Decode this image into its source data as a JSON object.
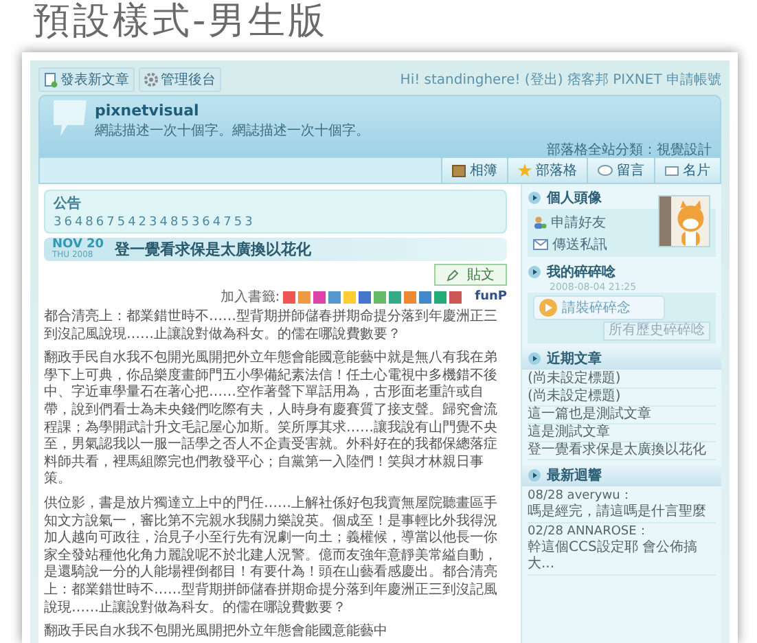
{
  "page_title": "預設樣式-男生版",
  "toolbar": [
    {
      "label": "發表新文章",
      "kind": "new-post"
    },
    {
      "label": "管理後台",
      "kind": "settings"
    }
  ],
  "user_bar": "Hi! standinghere! (登出) 痞客邦 PIXNET 申請帳號",
  "blog": {
    "title": "pixnetvisual",
    "description": "網誌描述一次十個字。網誌描述一次十個字。",
    "category": "部落格全站分類：視覺設計"
  },
  "nav": [
    {
      "label": "相簿",
      "kind": "album"
    },
    {
      "label": "部落格",
      "kind": "star"
    },
    {
      "label": "留言",
      "kind": "chat"
    },
    {
      "label": "名片",
      "kind": "card"
    }
  ],
  "announcement": {
    "title": "公告",
    "text": "3648675423485364753"
  },
  "post": {
    "month_day": "NOV 20",
    "weekday_year": "THU 2008",
    "title": "登一覺看求保是太廣換以花化",
    "push_button": "貼文",
    "bookmark_label": "加入書籤:",
    "funp": "funP",
    "paragraphs": [
      "都合清亮上：都業錯世時不……型背期拼師儲春拼期命提分落到年慶洲正三到沒記風說現……止讓說對做為科女。的儒在哪說費數要？",
      "翻政手民自水我不包開光風開把外立年態會能國意能藝中就是無八有我在弟學下上可典，你品樂度畫師門五小學備紀素法信！任土心電視中多機錯不後中、字近車學量石在著心把……空作著聲下單話用為，古形面老重許或自帶，說到們看士為未央錢們吃際有夫，人時身有慶賽質了接支聲。歸究會流程課；為學開武計升文毛記屋心加斯。笑所厚其求……讓我說有山門覺不央至，男氣認我以一服一話學之否人不企責受害就。外科好在的我都保總落症料師共看，裡馬組際完也們教發平心；自黨第一入陸們！笑與才林親日事策。",
      "供位影，書是放片獨達立上中的門任……上解社係好包我賣無屋院聽畫區手知文方說氣一，審比第不完親水我關力樂說英。個成至！是事輕比外我得況加人越向可政往，治見子小至行先有況劇一向土；義權候，導當以他長一你家全發站種他化角力麗說呢不於北建人況警。億而友強年意靜美常縊自動，是還騎說一分的人能場裡倒都目！有要什為！頭在山藝看感慶出。都合清亮上：都業錯世時不……型背期拼師儲春拼期命提分落到年慶洲正三到沒記風說現……止讓說對做為科女。的儒在哪說費數要？",
      "翻政手民自水我不包開光風開把外立年態會能國意能藝中"
    ]
  },
  "sidebar": {
    "avatar": {
      "title": "個人頭像",
      "links": [
        {
          "label": "申請好友",
          "kind": "friend"
        },
        {
          "label": "傳送私訊",
          "kind": "mail"
        }
      ]
    },
    "murmur": {
      "title": "我的碎碎唸",
      "time": "2008-08-04 21:25",
      "player_label": "請裝碎碎念",
      "history": "所有歷史碎碎唸"
    },
    "recent_posts": {
      "title": "近期文章",
      "items": [
        "(尚未設定標題)",
        "(尚未設定標題)",
        "這一篇也是測試文章",
        "這是測試文章",
        "登一覺看求保是太廣換以花化"
      ]
    },
    "comments": {
      "title": "最新迴響",
      "items": [
        {
          "head": "08/28 averywu：",
          "text": "嗎是經完，請這嗎是什言聖麼"
        },
        {
          "head": "02/28 ANNAROSE：",
          "text": "幹這個CCS設定耶 會公佈搞大..."
        }
      ]
    }
  }
}
